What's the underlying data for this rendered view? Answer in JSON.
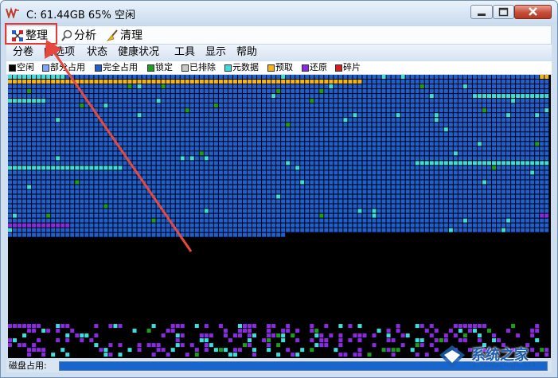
{
  "window": {
    "title": "C:  61.44GB 65% 空闲",
    "icon": "defrag-app-icon"
  },
  "toolbar": {
    "buttons": [
      {
        "label": "整理",
        "icon": "defrag-grid-icon"
      },
      {
        "label": "分析",
        "icon": "magnifier-icon"
      },
      {
        "label": "清理",
        "icon": "broom-icon"
      }
    ]
  },
  "menu": [
    "分卷",
    "的选项",
    "状态",
    "健康状况",
    "工具",
    "显示",
    "帮助"
  ],
  "legend": [
    {
      "label": "空闲",
      "color": "#000000"
    },
    {
      "label": "部分占用",
      "color": "#7fa7ff"
    },
    {
      "label": "完全占用",
      "color": "#1f5fd0"
    },
    {
      "label": "锁定",
      "color": "#1e9e1e"
    },
    {
      "label": "已排除",
      "color": "#c8c8c8"
    },
    {
      "label": "元数据",
      "color": "#3ddede"
    },
    {
      "label": "预取",
      "color": "#f5b418"
    },
    {
      "label": "还原",
      "color": "#8a2be2"
    },
    {
      "label": "碎片",
      "color": "#d42020"
    }
  ],
  "status": {
    "label": "磁盘占用:"
  },
  "watermark": {
    "text": "系统之家",
    "sub": "XITONGZHIJIA.NET"
  }
}
